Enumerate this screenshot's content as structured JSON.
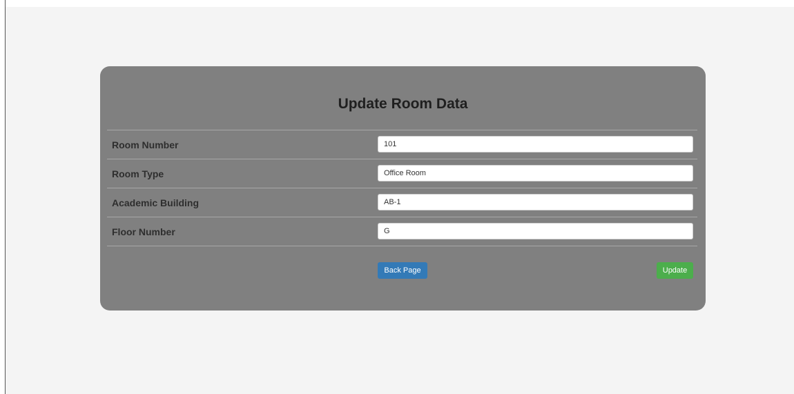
{
  "form": {
    "title": "Update Room Data",
    "fields": [
      {
        "label": "Room Number",
        "value": "101"
      },
      {
        "label": "Room Type",
        "value": "Office Room"
      },
      {
        "label": "Academic Building",
        "value": "AB-1"
      },
      {
        "label": "Floor Number",
        "value": "G"
      }
    ],
    "back_label": "Back Page",
    "update_label": "Update"
  },
  "colors": {
    "page_bg": "#f4f4f4",
    "card_bg": "#808080",
    "back_button": "#337ab7",
    "update_button": "#4cae4c"
  }
}
